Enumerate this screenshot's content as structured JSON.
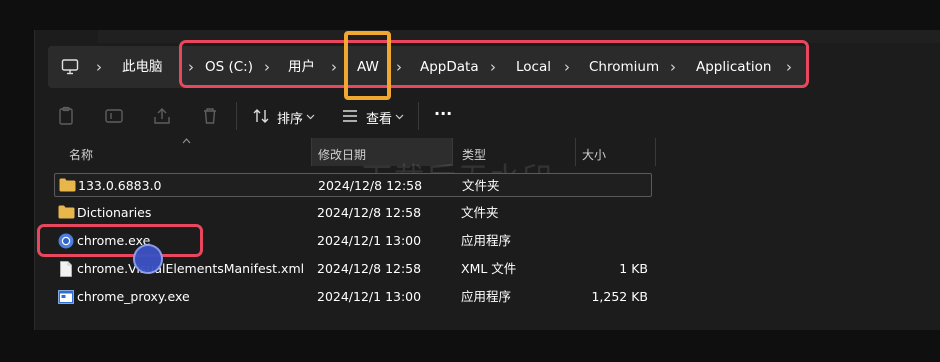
{
  "address_bar": {
    "crumbs": [
      "此电脑",
      "OS (C:)",
      "用户",
      "AW",
      "AppData",
      "Local",
      "Chromium",
      "Application"
    ],
    "separator": "›"
  },
  "toolbar": {
    "sort_label": "排序",
    "view_label": "查看",
    "more_label": "···"
  },
  "columns": {
    "name": "名称",
    "modified": "修改日期",
    "type": "类型",
    "size": "大小"
  },
  "files": [
    {
      "name": "133.0.6883.0",
      "modified": "2024/12/8 12:58",
      "type": "文件夹",
      "size": "",
      "icon": "folder-icon"
    },
    {
      "name": "Dictionaries",
      "modified": "2024/12/8 12:58",
      "type": "文件夹",
      "size": "",
      "icon": "folder-icon"
    },
    {
      "name": "chrome.exe",
      "modified": "2024/12/1 13:00",
      "type": "应用程序",
      "size": "",
      "icon": "chromium-icon"
    },
    {
      "name": "chrome.VisualElementsManifest.xml",
      "modified": "2024/12/8 12:58",
      "type": "XML 文件",
      "size": "1 KB",
      "icon": "document-icon"
    },
    {
      "name": "chrome_proxy.exe",
      "modified": "2024/12/1 13:00",
      "type": "应用程序",
      "size": "1,252 KB",
      "icon": "app-window-icon"
    }
  ],
  "watermark": "下载后无水印",
  "colors": {
    "highlight_red": "#e8475d",
    "highlight_yellow": "#f0a830",
    "folder": "#e8b64a",
    "background": "#1c1c1c"
  }
}
